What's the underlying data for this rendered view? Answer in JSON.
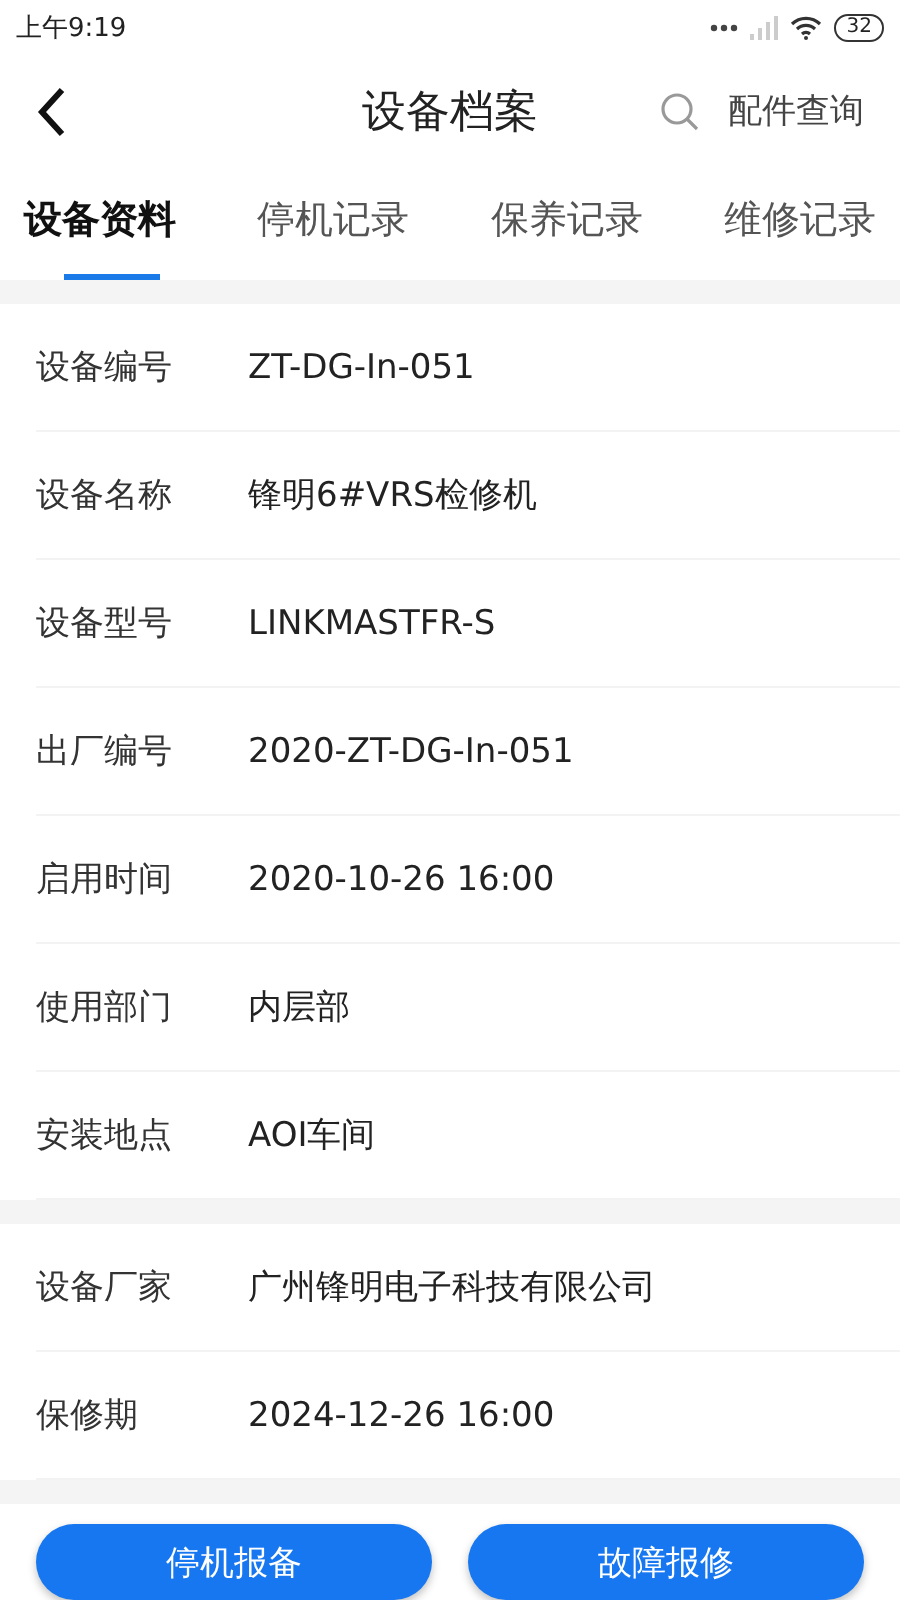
{
  "status_bar": {
    "time": "上午9:19",
    "battery": "32"
  },
  "header": {
    "title": "设备档案",
    "search_link": "配件查询"
  },
  "tabs": [
    {
      "label": "设备资料",
      "selected": true
    },
    {
      "label": "停机记录",
      "selected": false
    },
    {
      "label": "保养记录",
      "selected": false
    },
    {
      "label": "维修记录",
      "selected": false
    }
  ],
  "sections": [
    {
      "rows": [
        {
          "label": "设备编号",
          "value": "ZT-DG-In-051"
        },
        {
          "label": "设备名称",
          "value": "锋明6#VRS检修机"
        },
        {
          "label": "设备型号",
          "value": "LINKMASTFR-S"
        },
        {
          "label": "出厂编号",
          "value": "2020-ZT-DG-In-051"
        },
        {
          "label": "启用时间",
          "value": "2020-10-26 16:00"
        },
        {
          "label": "使用部门",
          "value": "内层部"
        },
        {
          "label": "安装地点",
          "value": "AOI车间"
        }
      ]
    },
    {
      "rows": [
        {
          "label": "设备厂家",
          "value": "广州锋明电子科技有限公司"
        },
        {
          "label": "保修期",
          "value": "2024-12-26 16:00"
        }
      ]
    }
  ],
  "buttons": [
    "停机报备",
    "故障报修"
  ]
}
